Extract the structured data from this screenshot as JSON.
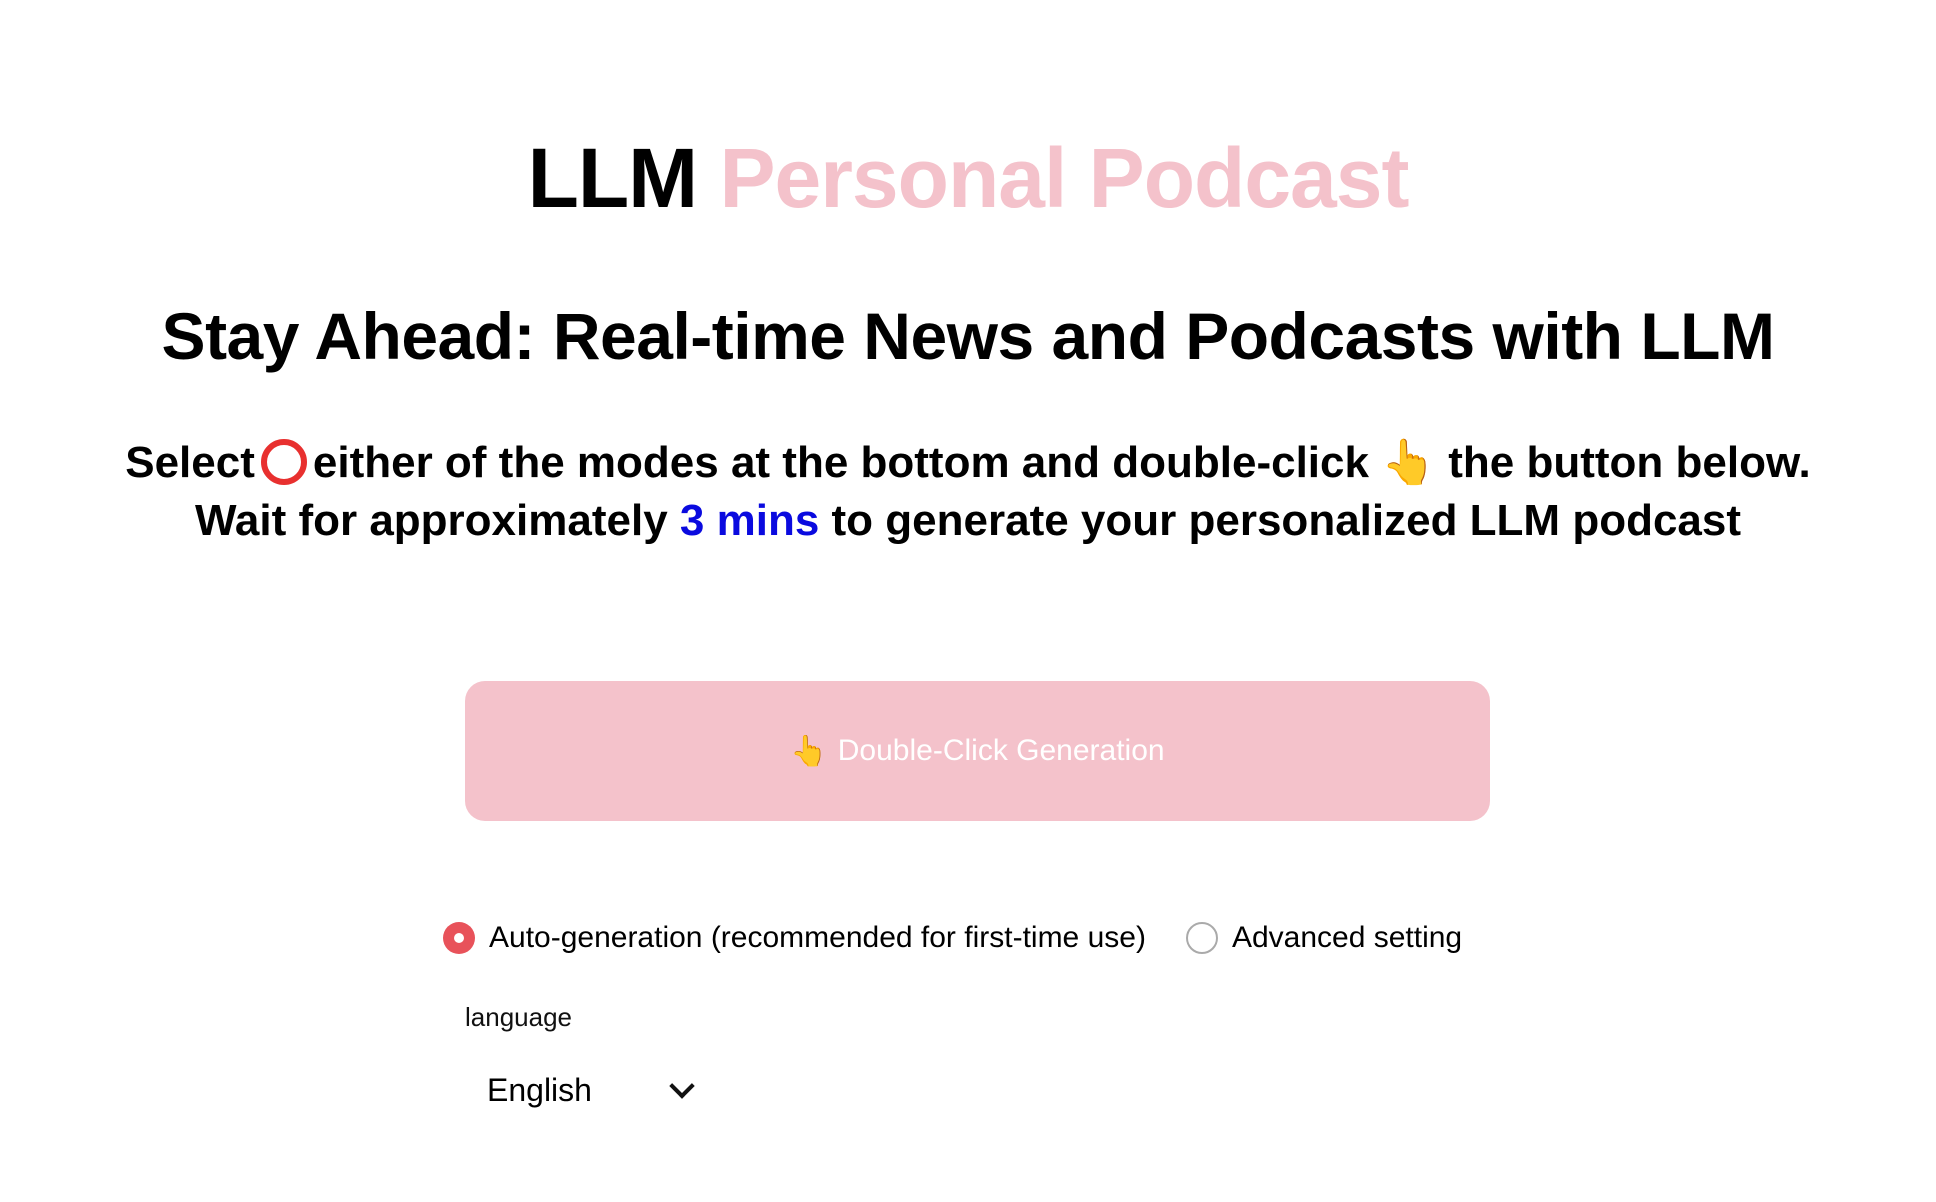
{
  "header": {
    "title_plain": "LLM",
    "title_accent": "Personal Podcast",
    "subtitle": "Stay Ahead: Real-time News and Podcasts with LLM"
  },
  "instructions": {
    "line1_part1": "Select",
    "line1_part2": "either of the modes at the bottom and double-click",
    "line1_part3": "the button below.",
    "line2_part1": "Wait for approximately",
    "line2_highlight": "3 mins",
    "line2_part2": "to generate your personalized LLM podcast",
    "ring_icon": "red-circle-icon",
    "pointer_icon": "pointing-hand-icon",
    "pointer_glyph": "👆"
  },
  "generate_button": {
    "icon_glyph": "👆",
    "label": "Double-Click Generation"
  },
  "modes": {
    "options": [
      {
        "label": "Auto-generation (recommended for first-time use)",
        "selected": true
      },
      {
        "label": "Advanced setting",
        "selected": false
      }
    ]
  },
  "language": {
    "label": "language",
    "selected": "English"
  },
  "colors": {
    "accent_pink": "#f4c2cb",
    "highlight_blue": "#0a0adf",
    "radio_red": "#e8525a"
  }
}
